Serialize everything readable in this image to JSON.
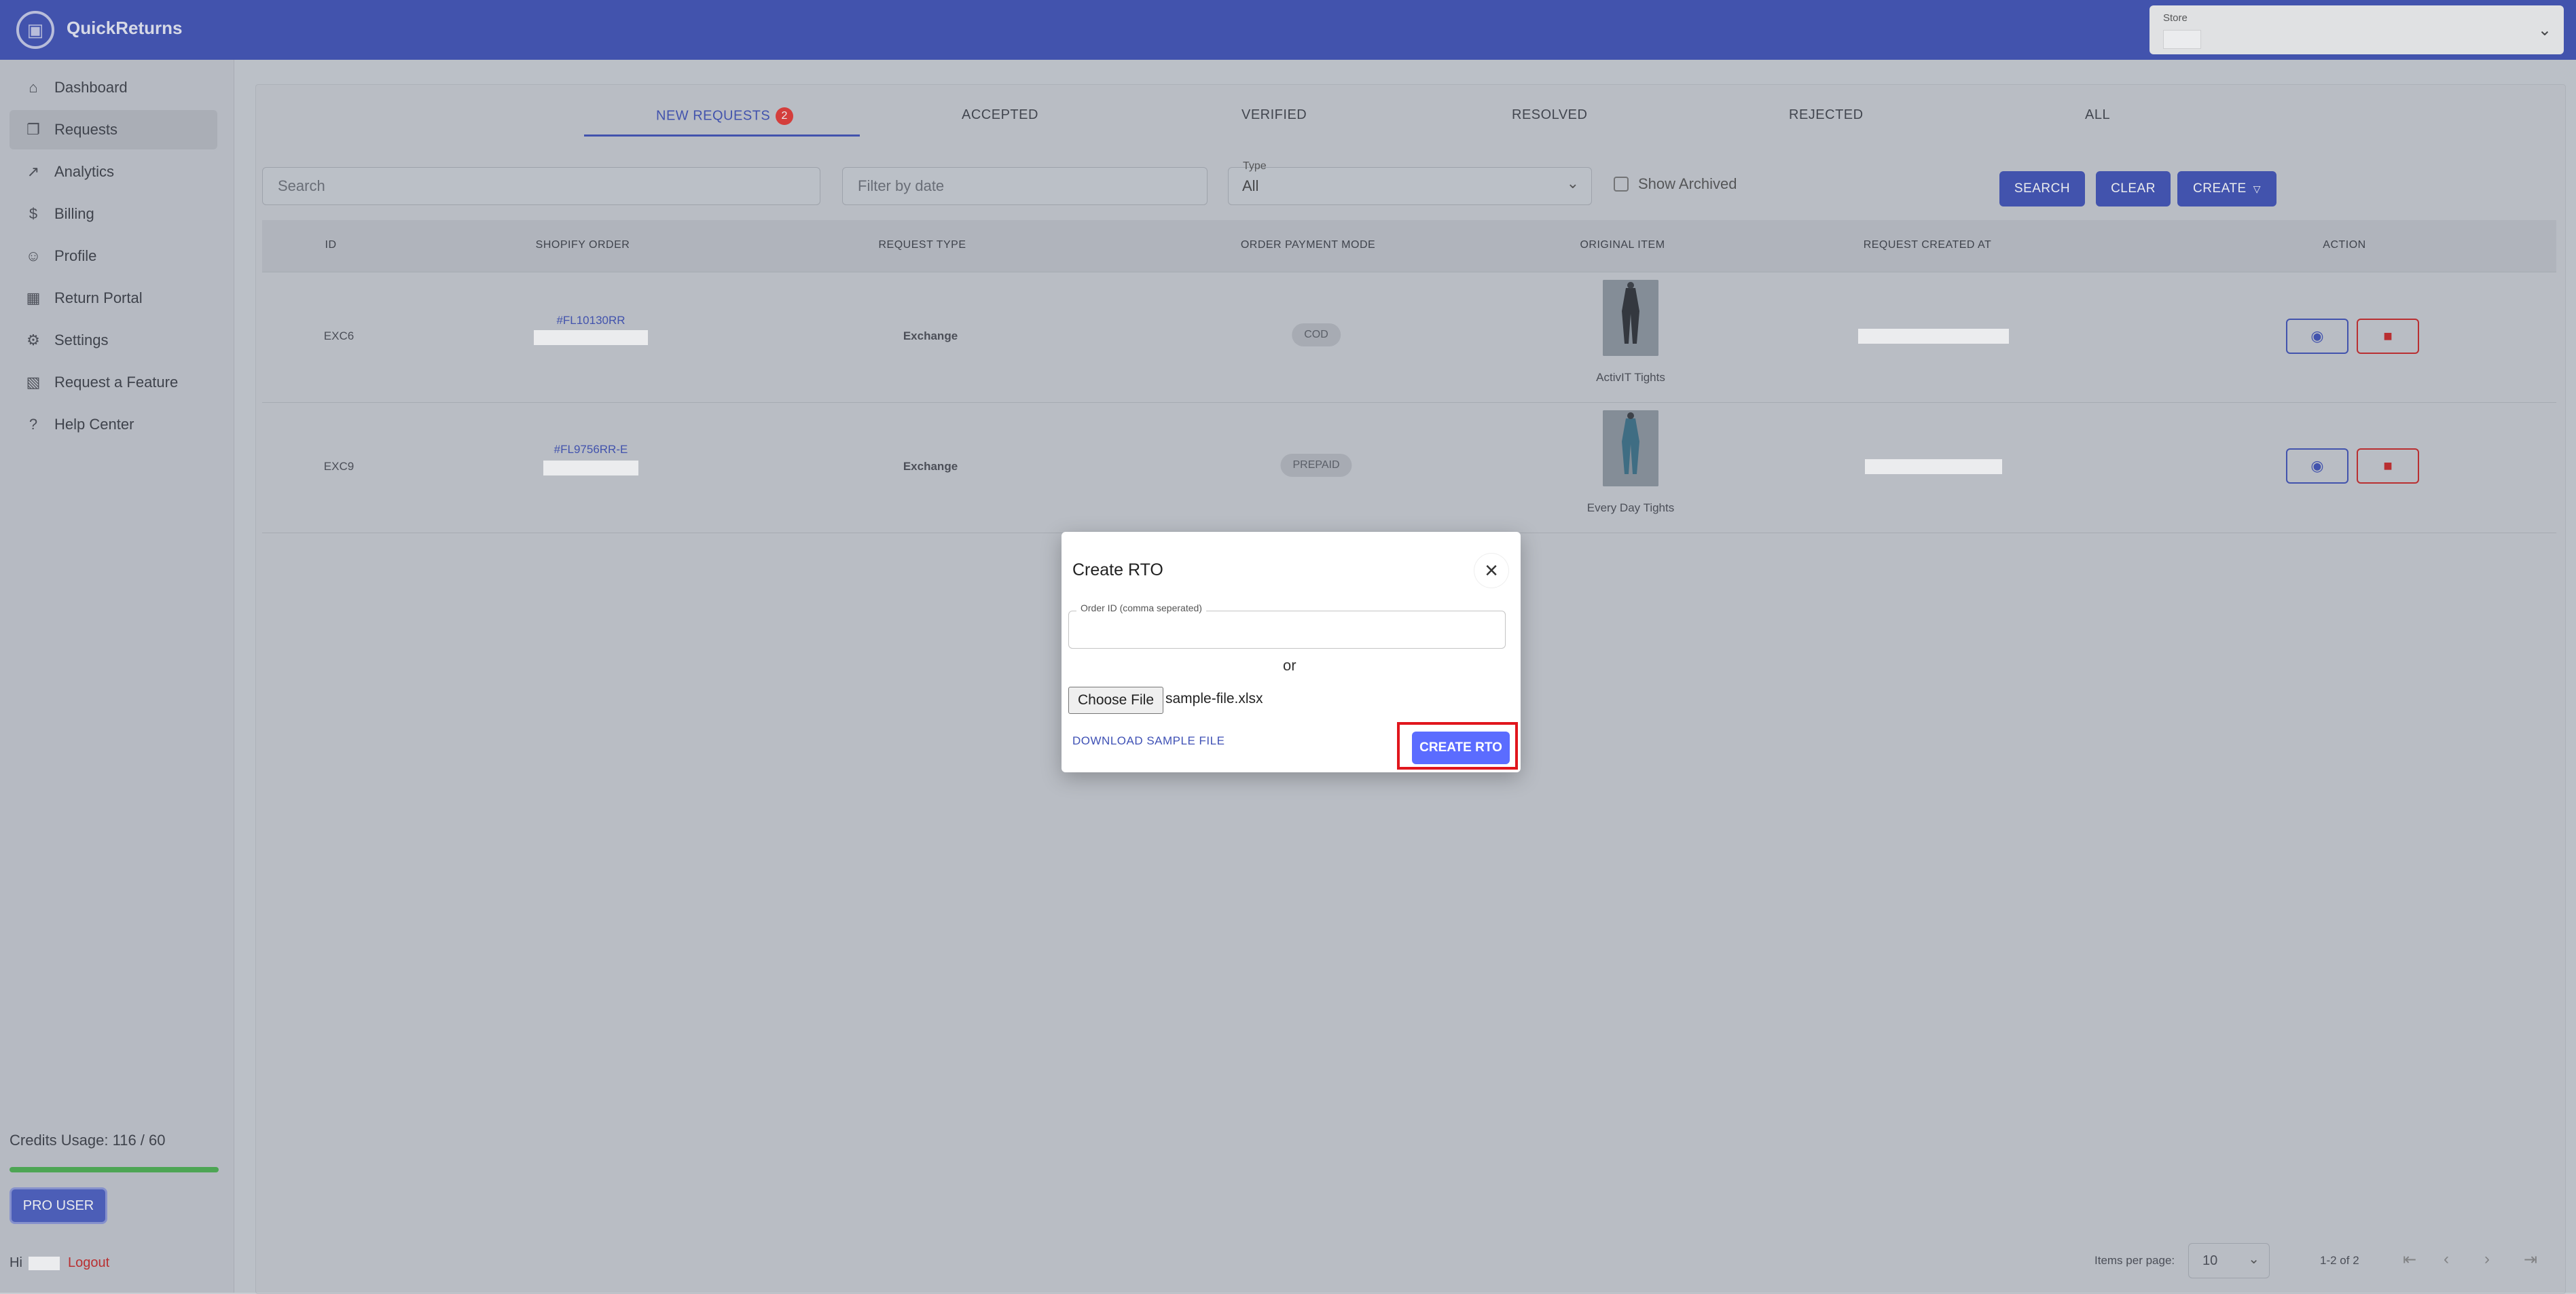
{
  "app": {
    "title": "QuickReturns",
    "store_label": "Store"
  },
  "sidebar": {
    "items": [
      {
        "label": "Dashboard",
        "icon": "home-icon"
      },
      {
        "label": "Requests",
        "icon": "package-icon"
      },
      {
        "label": "Analytics",
        "icon": "chart-line-icon"
      },
      {
        "label": "Billing",
        "icon": "dollar-icon"
      },
      {
        "label": "Profile",
        "icon": "user-icon"
      },
      {
        "label": "Return Portal",
        "icon": "grid-icon"
      },
      {
        "label": "Settings",
        "icon": "gear-icon"
      },
      {
        "label": "Request a Feature",
        "icon": "feature-request-icon"
      },
      {
        "label": "Help Center",
        "icon": "question-icon"
      }
    ],
    "credits_label": "Credits Usage: 116 / 60",
    "credits_used": 116,
    "credits_total": 60,
    "pro_button": "PRO USER",
    "hi_text": "Hi",
    "logout": "Logout"
  },
  "tabs": [
    {
      "label": "NEW REQUESTS",
      "badge": "2"
    },
    {
      "label": "ACCEPTED"
    },
    {
      "label": "VERIFIED"
    },
    {
      "label": "RESOLVED"
    },
    {
      "label": "REJECTED"
    },
    {
      "label": "ALL"
    }
  ],
  "filters": {
    "search_placeholder": "Search",
    "date_placeholder": "Filter by date",
    "type_label": "Type",
    "type_value": "All",
    "show_archived": "Show Archived",
    "search_btn": "SEARCH",
    "clear_btn": "CLEAR",
    "create_btn": "CREATE"
  },
  "table": {
    "headers": [
      "ID",
      "SHOPIFY ORDER",
      "REQUEST TYPE",
      "ORDER PAYMENT MODE",
      "ORIGINAL ITEM",
      "REQUEST CREATED AT",
      "ACTION"
    ],
    "rows": [
      {
        "id": "EXC6",
        "order": "#FL10130RR",
        "type": "Exchange",
        "payment": "COD",
        "item": "ActivIT Tights"
      },
      {
        "id": "EXC9",
        "order": "#FL9756RR-E",
        "type": "Exchange",
        "payment": "PREPAID",
        "item": "Every Day Tights"
      }
    ]
  },
  "pagination": {
    "items_per_page_label": "Items per page:",
    "per_page": "10",
    "range": "1-2 of 2"
  },
  "dialog": {
    "title": "Create RTO",
    "order_id_label": "Order ID (comma seperated)",
    "or_text": "or",
    "choose_file": "Choose File",
    "file_name": "sample-file.xlsx",
    "download_link": "DOWNLOAD SAMPLE FILE",
    "create_button": "CREATE RTO"
  }
}
